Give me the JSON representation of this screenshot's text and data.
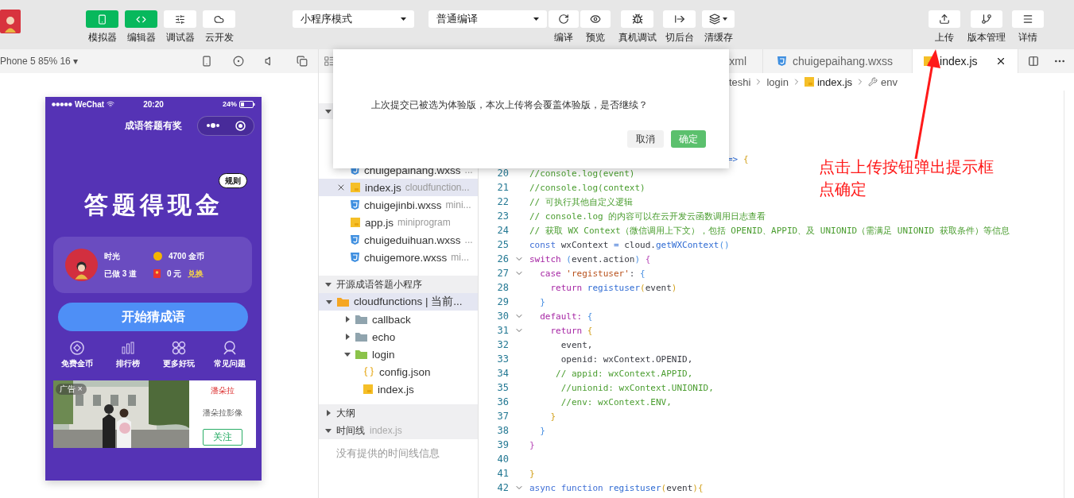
{
  "toolbar": {
    "view_toggles": [
      {
        "label": "模拟器",
        "selected": true
      },
      {
        "label": "编辑器",
        "selected": true
      },
      {
        "label": "调试器",
        "selected": false
      },
      {
        "label": "云开发",
        "selected": false
      }
    ],
    "mode_select": "小程序模式",
    "compile_select": "普通编译",
    "actions": [
      {
        "label": "编译",
        "caret": false
      },
      {
        "label": "预览",
        "caret": false
      },
      {
        "label": "真机调试",
        "caret": false
      },
      {
        "label": "切后台",
        "caret": false
      },
      {
        "label": "清缓存",
        "caret": true
      }
    ],
    "right_actions": [
      {
        "label": "上传"
      },
      {
        "label": "版本管理"
      },
      {
        "label": "详情"
      }
    ]
  },
  "simulator": {
    "device": "Phone 5 85% 16 ▾",
    "phone": {
      "carrier": "WeChat",
      "time": "20:20",
      "battery": "24%",
      "nav_title": "成语答题有奖",
      "rules": "规则",
      "headline": "答题得现金",
      "user": {
        "name": "时光",
        "done": "已做 3 道",
        "coins": "4700 金币",
        "cash": "0 元",
        "exchange": "兑换"
      },
      "start_button": "开始猜成语",
      "menu": [
        {
          "label": "免费金币"
        },
        {
          "label": "排行榜"
        },
        {
          "label": "更多好玩"
        },
        {
          "label": "常见问题"
        }
      ],
      "ad": {
        "tag": "广告",
        "close": "×",
        "brand": "潘朵拉",
        "name": "潘朵拉影像",
        "follow": "关注"
      }
    }
  },
  "explorer": {
    "open_files": [
      {
        "name": "chuigepaihang.wxss",
        "path": "...",
        "kind": "css",
        "selected": false
      },
      {
        "name": "index.js",
        "path": "cloudfunction...",
        "kind": "js",
        "selected": true
      },
      {
        "name": "chuigejinbi.wxss",
        "path": "mini...",
        "kind": "css",
        "selected": false
      },
      {
        "name": "app.js",
        "path": "miniprogram",
        "kind": "js",
        "selected": false
      },
      {
        "name": "chuigeduihuan.wxss",
        "path": "...",
        "kind": "css",
        "selected": false
      },
      {
        "name": "chuigemore.wxss",
        "path": "mi...",
        "kind": "css",
        "selected": false
      }
    ],
    "project": {
      "title": "开源成语答题小程序",
      "expanded": true,
      "tree": [
        {
          "name": "cloudfunctions | 当前...",
          "kind": "root-folder",
          "expanded": true,
          "selected": true,
          "children": [
            {
              "name": "callback",
              "kind": "folder",
              "expanded": false,
              "selected": false
            },
            {
              "name": "echo",
              "kind": "folder",
              "expanded": false,
              "selected": false
            },
            {
              "name": "login",
              "kind": "function-folder",
              "expanded": true,
              "selected": false,
              "children": [
                {
                  "name": "config.json",
                  "kind": "json",
                  "selected": false
                },
                {
                  "name": "index.js",
                  "kind": "js",
                  "selected": false
                }
              ]
            }
          ]
        }
      ]
    },
    "outline": {
      "title": "大纲",
      "expanded": false
    },
    "timeline": {
      "title": "时间线",
      "file": "index.js",
      "expanded": true,
      "message": "没有提供的时间线信息"
    }
  },
  "editor": {
    "tabs": [
      {
        "label": "xml",
        "kind": "plain",
        "selected": false
      },
      {
        "label": "chuigepaihang.wxss",
        "kind": "css",
        "selected": false
      },
      {
        "label": "index.js",
        "kind": "js",
        "selected": true
      }
    ],
    "breadcrumb": [
      "teshi",
      "login",
      "index.js",
      "env"
    ],
    "lines": [
      {
        "kind": "partial",
        "fold": false,
        "code": [
          {
            "kind": "op",
            "t": "=> "
          },
          {
            "kind": "p1",
            "t": "{"
          }
        ]
      },
      {
        "kind": "full",
        "n": "20",
        "fold": false,
        "code": [
          {
            "kind": "com",
            "t": "//console.log(event)"
          }
        ]
      },
      {
        "kind": "full",
        "n": "21",
        "fold": false,
        "code": [
          {
            "kind": "com",
            "t": "//console.log(context)"
          }
        ]
      },
      {
        "kind": "full",
        "n": "22",
        "fold": false,
        "code": [
          {
            "kind": "com",
            "t": "// 可执行其他自定义逻辑"
          }
        ]
      },
      {
        "kind": "full",
        "n": "23",
        "fold": false,
        "code": [
          {
            "kind": "com",
            "t": "// console.log 的内容可以在云开发云函数调用日志查看"
          }
        ]
      },
      {
        "kind": "full",
        "n": "24",
        "fold": false,
        "code": [
          {
            "kind": "com",
            "t": "// 获取 WX Context（微信调用上下文），包括 OPENID、APPID、及 UNIONID（需满足 UNIONID 获取条件）等信息"
          }
        ]
      },
      {
        "kind": "full",
        "n": "25",
        "fold": false,
        "code": [
          {
            "kind": "kw2",
            "t": "const "
          },
          {
            "kind": "id",
            "t": "wxContext "
          },
          {
            "kind": "op",
            "t": "= "
          },
          {
            "kind": "id",
            "t": "cloud."
          },
          {
            "kind": "fn",
            "t": "getWXContext"
          },
          {
            "kind": "p2",
            "t": "()"
          }
        ]
      },
      {
        "kind": "full",
        "n": "26",
        "fold": true,
        "code": [
          {
            "kind": "kw",
            "t": "switch "
          },
          {
            "kind": "p2",
            "t": "("
          },
          {
            "kind": "id",
            "t": "event.action"
          },
          {
            "kind": "p2",
            "t": ") "
          },
          {
            "kind": "p3",
            "t": "{"
          }
        ]
      },
      {
        "kind": "full",
        "n": "27",
        "fold": true,
        "code": [
          {
            "kind": "kw",
            "t": "  case "
          },
          {
            "kind": "str",
            "t": "'registuser'"
          },
          {
            "kind": "id",
            "t": ": "
          },
          {
            "kind": "p2",
            "t": "{"
          }
        ]
      },
      {
        "kind": "full",
        "n": "28",
        "fold": false,
        "code": [
          {
            "kind": "kw",
            "t": "    return "
          },
          {
            "kind": "fn",
            "t": "registuser"
          },
          {
            "kind": "p1",
            "t": "("
          },
          {
            "kind": "id",
            "t": "event"
          },
          {
            "kind": "p1",
            "t": ")"
          }
        ]
      },
      {
        "kind": "full",
        "n": "29",
        "fold": false,
        "code": [
          {
            "kind": "p2",
            "t": "  }"
          }
        ]
      },
      {
        "kind": "full",
        "n": "30",
        "fold": true,
        "code": [
          {
            "kind": "kw",
            "t": "  default: "
          },
          {
            "kind": "p2",
            "t": "{"
          }
        ]
      },
      {
        "kind": "full",
        "n": "31",
        "fold": true,
        "code": [
          {
            "kind": "kw",
            "t": "    return "
          },
          {
            "kind": "p1",
            "t": "{"
          }
        ]
      },
      {
        "kind": "full",
        "n": "32",
        "fold": false,
        "code": [
          {
            "kind": "id",
            "t": "      event,"
          }
        ]
      },
      {
        "kind": "full",
        "n": "33",
        "fold": false,
        "code": [
          {
            "kind": "id",
            "t": "      openid: wxContext.OPENID,"
          }
        ]
      },
      {
        "kind": "full",
        "n": "34",
        "fold": false,
        "code": [
          {
            "kind": "com",
            "t": "     // appid: wxContext.APPID,"
          }
        ]
      },
      {
        "kind": "full",
        "n": "35",
        "fold": false,
        "code": [
          {
            "kind": "com",
            "t": "      //unionid: wxContext.UNIONID,"
          }
        ]
      },
      {
        "kind": "full",
        "n": "36",
        "fold": false,
        "code": [
          {
            "kind": "com",
            "t": "      //env: wxContext.ENV,"
          }
        ]
      },
      {
        "kind": "full",
        "n": "37",
        "fold": false,
        "code": [
          {
            "kind": "p1",
            "t": "    }"
          }
        ]
      },
      {
        "kind": "full",
        "n": "38",
        "fold": false,
        "code": [
          {
            "kind": "p2",
            "t": "  }"
          }
        ]
      },
      {
        "kind": "full",
        "n": "39",
        "fold": false,
        "code": [
          {
            "kind": "p3",
            "t": "}"
          }
        ]
      },
      {
        "kind": "full",
        "n": "40",
        "fold": false
      },
      {
        "kind": "full",
        "n": "41",
        "fold": false,
        "code": [
          {
            "kind": "p1",
            "t": "}"
          }
        ]
      },
      {
        "kind": "full",
        "n": "42",
        "fold": true,
        "code": [
          {
            "kind": "kw2",
            "t": "async function "
          },
          {
            "kind": "fn",
            "t": "registuser"
          },
          {
            "kind": "p1",
            "t": "("
          },
          {
            "kind": "id",
            "t": "event"
          },
          {
            "kind": "p1",
            "t": "){"
          }
        ]
      }
    ]
  },
  "dialog": {
    "message": "上次提交已被选为体验版，本次上传将会覆盖体验版，是否继续？",
    "buttons": [
      {
        "label": "取消",
        "kind": "secondary"
      },
      {
        "label": "确定",
        "kind": "primary"
      }
    ]
  },
  "annotation": {
    "lines": [
      "点击上传按钮弹出提示框",
      "点确定"
    ]
  }
}
